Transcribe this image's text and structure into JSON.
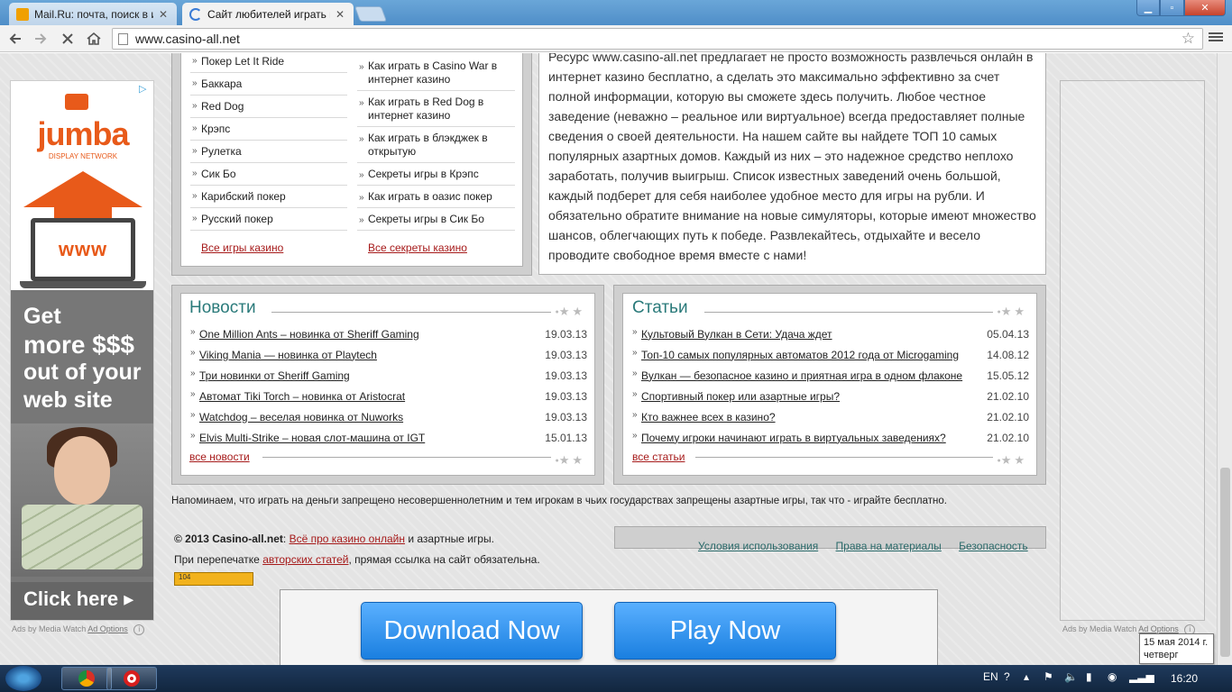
{
  "browser": {
    "tabs": [
      {
        "title": "Mail.Ru: почта, поиск в и",
        "active": false
      },
      {
        "title": "Сайт любителей играть в",
        "active": true
      }
    ],
    "url": "www.casino-all.net"
  },
  "left_ad": {
    "brand": "jumba",
    "brand_sub": "DISPLAY NETWORK",
    "screen_text": "www",
    "slogan": [
      "Get",
      "more $$$",
      "out of your",
      "web site"
    ],
    "cta": "Click here ▸",
    "label": "Ads by Media Watch",
    "options": "Ad Options"
  },
  "right_ad": {
    "label": "Ads by Media Watch",
    "options": "Ad Options"
  },
  "menu": {
    "col1": [
      "Покер Let It Ride",
      "Баккара",
      "Red Dog",
      "Крэпс",
      "Рулетка",
      "Сик Бо",
      "Карибский покер",
      "Русский покер"
    ],
    "col1_more": "Все игры казино",
    "col2": [
      "Как играть в Casino War в интернет казино",
      "Как играть в Red Dog в интернет казино",
      "Как играть в блэкджек в открытую",
      "Секреты игры в Крэпс",
      "Как играть в оазис покер",
      "Секреты игры в Сик Бо"
    ],
    "col2_more": "Все секреты казино"
  },
  "intro": "Ресурс www.casino-all.net предлагает не просто возможность развлечься онлайн в интернет казино бесплатно, а сделать это максимально эффективно за счет полной информации, которую вы сможете здесь получить. Любое честное заведение (неважно – реальное или виртуальное) всегда предоставляет полные сведения о своей деятельности. На нашем сайте вы найдете ТОП 10 самых популярных азартных домов. Каждый из них – это надежное средство неплохо заработать, получив выигрыш. Список известных заведений очень большой, каждый подберет для себя наиболее удобное место для игры на рубли. И обязательно обратите внимание на новые симуляторы, которые имеют множество шансов, облегчающих путь к победе. Развлекайтесь, отдыхайте и весело проводите свободное время вместе с нами!",
  "news": {
    "title": "Новости",
    "items": [
      {
        "text": "One Million Ants – новинка от Sheriff Gaming",
        "date": "19.03.13"
      },
      {
        "text": "Viking Mania — новинка от Playtech",
        "date": "19.03.13"
      },
      {
        "text": "Три новинки от Sheriff Gaming",
        "date": "19.03.13"
      },
      {
        "text": "Автомат Tiki Torch – новинка от Aristocrat",
        "date": "19.03.13"
      },
      {
        "text": "Watchdog – веселая новинка от Nuworks",
        "date": "19.03.13"
      },
      {
        "text": "Elvis Multi-Strike – новая слот-машина от IGT",
        "date": "15.01.13"
      }
    ],
    "more": "все новости"
  },
  "articles": {
    "title": "Статьи",
    "items": [
      {
        "text": "Культовый Вулкан в Сети: Удача ждет",
        "date": "05.04.13"
      },
      {
        "text": "Топ-10 самых популярных автоматов 2012 года от Microgaming",
        "date": "14.08.12"
      },
      {
        "text": "Вулкан — безопасное казино и приятная игра в одном флаконе",
        "date": "15.05.12"
      },
      {
        "text": "Спортивный покер или азартные игры?",
        "date": "21.02.10"
      },
      {
        "text": "Кто важнее всех в казино?",
        "date": "21.02.10"
      },
      {
        "text": "Почему игроки начинают играть в виртуальных заведениях?",
        "date": "21.02.10"
      }
    ],
    "more": "все статьи"
  },
  "footer": {
    "disclaimer": "Напоминаем, что играть на деньги запрещено несовершеннолетним и тем игрокам в чьих государствах запрещены азартные игры, так что - играйте бесплатно.",
    "copyright": "© 2013 Casino-all.net",
    "colon": ":",
    "link1": "Всё про казино онлайн",
    "after1": "и азартные игры.",
    "reprint": "При перепечатке",
    "link2": "авторских статей",
    "after2": ", прямая ссылка на сайт обязательна.",
    "counter": "104",
    "links": [
      "Условия использования",
      "Права на материалы",
      "Безопасность"
    ]
  },
  "bottom_ad": {
    "btn1": "Download Now",
    "btn2": "Play Now"
  },
  "tooltip": {
    "date": "15 мая 2014 г.",
    "day": "четверг"
  },
  "taskbar": {
    "lang": "EN",
    "time": "16:20"
  }
}
